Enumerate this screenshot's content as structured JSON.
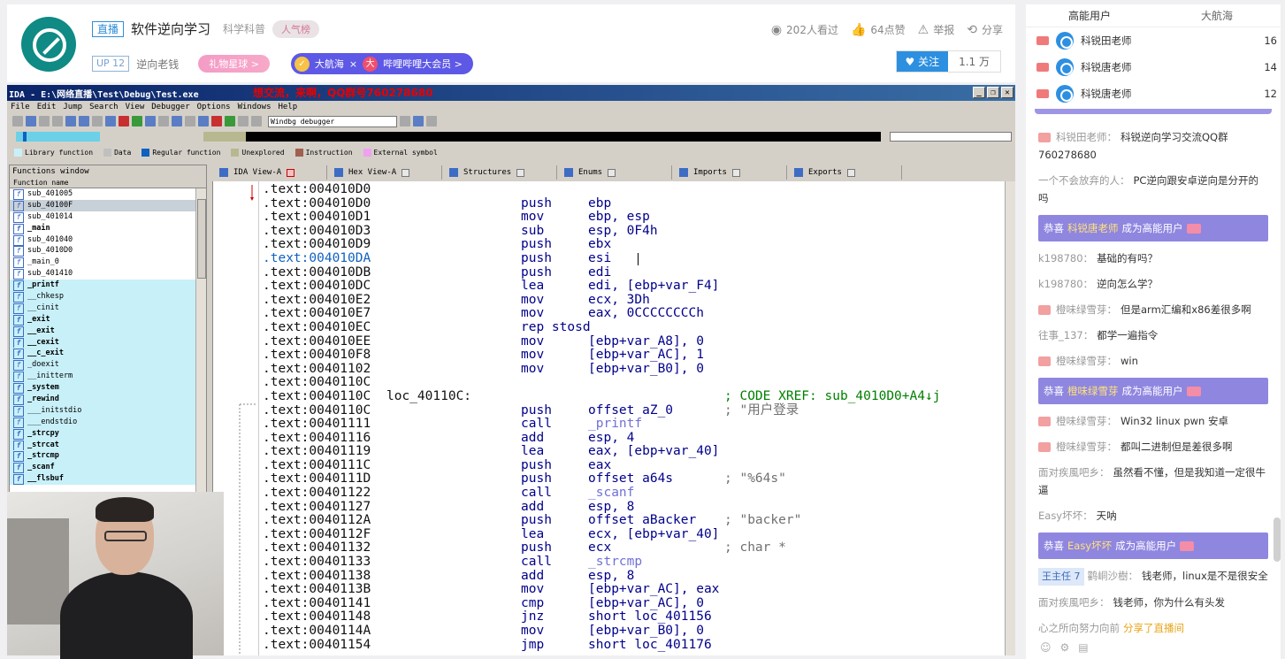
{
  "header": {
    "live_tag": "直播",
    "room_title": "软件逆向学习",
    "category": "科学科普",
    "popularity_badge": "人气榜",
    "up_level": "UP 12",
    "anchor_name": "逆向老钱",
    "gift_btn": "礼物星球 >",
    "guard_a": "大航海",
    "guard_sep": "×",
    "guard_b": "哔哩哔哩大会员 >",
    "viewers": "202人看过",
    "likes": "64点赞",
    "report": "举报",
    "share": "分享",
    "follow": "关注",
    "followers": "1.1 万"
  },
  "ida": {
    "title": "IDA - E:\\网络直播\\Test\\Debug\\Test.exe",
    "overlay": "想交流，来啊，QQ群号760278680",
    "menu": [
      "File",
      "Edit",
      "Jump",
      "Search",
      "View",
      "Debugger",
      "Options",
      "Windows",
      "Help"
    ],
    "debugger_select": "Windbg debugger",
    "legend": [
      "Library function",
      "Data",
      "Regular function",
      "Unexplored",
      "Instruction",
      "External symbol"
    ],
    "legend_colors": [
      "#c8f0f8",
      "#c0c0c0",
      "#1060c0",
      "#b8b890",
      "#a06050",
      "#f0a0f0"
    ],
    "functions_window_title": "Functions window",
    "function_column": "Function name",
    "functions": [
      {
        "name": "sub_401005",
        "style": "normal"
      },
      {
        "name": "sub_40100F",
        "style": "sel"
      },
      {
        "name": "sub_401014",
        "style": "normal"
      },
      {
        "name": "_main",
        "style": "bold"
      },
      {
        "name": "sub_401040",
        "style": "normal"
      },
      {
        "name": "sub_4010D0",
        "style": "normal"
      },
      {
        "name": "_main_0",
        "style": "normal"
      },
      {
        "name": "sub_401410",
        "style": "normal"
      },
      {
        "name": "_printf",
        "style": "lib bold"
      },
      {
        "name": "__chkesp",
        "style": "lib"
      },
      {
        "name": "__cinit",
        "style": "lib"
      },
      {
        "name": "_exit",
        "style": "lib bold"
      },
      {
        "name": "__exit",
        "style": "lib bold"
      },
      {
        "name": "__cexit",
        "style": "lib bold"
      },
      {
        "name": "__c_exit",
        "style": "lib bold"
      },
      {
        "name": "_doexit",
        "style": "lib"
      },
      {
        "name": "__initterm",
        "style": "lib"
      },
      {
        "name": "_system",
        "style": "lib bold"
      },
      {
        "name": "_rewind",
        "style": "lib bold"
      },
      {
        "name": "___initstdio",
        "style": "lib"
      },
      {
        "name": "___endstdio",
        "style": "lib"
      },
      {
        "name": "_strcpy",
        "style": "lib bold"
      },
      {
        "name": "_strcat",
        "style": "lib bold"
      },
      {
        "name": "_strcmp",
        "style": "lib bold"
      },
      {
        "name": "_scanf",
        "style": "lib bold"
      },
      {
        "name": "__flsbuf",
        "style": "lib bold"
      }
    ],
    "tabs": [
      "IDA View-A",
      "Hex View-A",
      "Structures",
      "Enums",
      "Imports",
      "Exports"
    ],
    "code": [
      {
        "addr": ".text:004010D0",
        "label": "",
        "mn": "",
        "op": "",
        "cm": ""
      },
      {
        "addr": ".text:004010D0",
        "label": "",
        "mn": "push",
        "op": "ebp",
        "cm": ""
      },
      {
        "addr": ".text:004010D1",
        "label": "",
        "mn": "mov",
        "op": "ebp, esp",
        "cm": ""
      },
      {
        "addr": ".text:004010D3",
        "label": "",
        "mn": "sub",
        "op": "esp, 0F4h",
        "cm": ""
      },
      {
        "addr": ".text:004010D9",
        "label": "",
        "mn": "push",
        "op": "ebx",
        "cm": ""
      },
      {
        "addr": ".text:004010DA",
        "label": "",
        "mn": "push",
        "op": "esi",
        "cm": ""
      },
      {
        "addr": ".text:004010DB",
        "label": "",
        "mn": "push",
        "op": "edi",
        "cm": ""
      },
      {
        "addr": ".text:004010DC",
        "label": "",
        "mn": "lea",
        "op": "edi, [ebp+var_F4]",
        "cm": ""
      },
      {
        "addr": ".text:004010E2",
        "label": "",
        "mn": "mov",
        "op": "ecx, 3Dh",
        "cm": ""
      },
      {
        "addr": ".text:004010E7",
        "label": "",
        "mn": "mov",
        "op": "eax, 0CCCCCCCCh",
        "cm": ""
      },
      {
        "addr": ".text:004010EC",
        "label": "",
        "mn": "rep stosd",
        "op": "",
        "cm": ""
      },
      {
        "addr": ".text:004010EE",
        "label": "",
        "mn": "mov",
        "op": "[ebp+var_A8], 0",
        "cm": ""
      },
      {
        "addr": ".text:004010F8",
        "label": "",
        "mn": "mov",
        "op": "[ebp+var_AC], 1",
        "cm": ""
      },
      {
        "addr": ".text:00401102",
        "label": "",
        "mn": "mov",
        "op": "[ebp+var_B0], 0",
        "cm": ""
      },
      {
        "addr": ".text:0040110C",
        "label": "",
        "mn": "",
        "op": "",
        "cm": ""
      },
      {
        "addr": ".text:0040110C",
        "label": "loc_40110C:",
        "mn": "",
        "op": "",
        "cm": "",
        "xref": "; CODE XREF: sub_4010D0+A4↓j"
      },
      {
        "addr": ".text:0040110C",
        "label": "",
        "mn": "push",
        "op": "offset aZ_0",
        "cm": "; \"用户登录"
      },
      {
        "addr": ".text:00401111",
        "label": "",
        "mn": "call",
        "op": "_printf",
        "cm": "",
        "fn": true
      },
      {
        "addr": ".text:00401116",
        "label": "",
        "mn": "add",
        "op": "esp, 4",
        "cm": ""
      },
      {
        "addr": ".text:00401119",
        "label": "",
        "mn": "lea",
        "op": "eax, [ebp+var_40]",
        "cm": ""
      },
      {
        "addr": ".text:0040111C",
        "label": "",
        "mn": "push",
        "op": "eax",
        "cm": ""
      },
      {
        "addr": ".text:0040111D",
        "label": "",
        "mn": "push",
        "op": "offset a64s",
        "cm": "; \"%64s\""
      },
      {
        "addr": ".text:00401122",
        "label": "",
        "mn": "call",
        "op": "_scanf",
        "cm": "",
        "fn": true
      },
      {
        "addr": ".text:00401127",
        "label": "",
        "mn": "add",
        "op": "esp, 8",
        "cm": ""
      },
      {
        "addr": ".text:0040112A",
        "label": "",
        "mn": "push",
        "op": "offset aBacker",
        "cm": "; \"backer\""
      },
      {
        "addr": ".text:0040112F",
        "label": "",
        "mn": "lea",
        "op": "ecx, [ebp+var_40]",
        "cm": ""
      },
      {
        "addr": ".text:00401132",
        "label": "",
        "mn": "push",
        "op": "ecx",
        "cm": "; char *"
      },
      {
        "addr": ".text:00401133",
        "label": "",
        "mn": "call",
        "op": "_strcmp",
        "cm": "",
        "fn": true
      },
      {
        "addr": ".text:00401138",
        "label": "",
        "mn": "add",
        "op": "esp, 8",
        "cm": ""
      },
      {
        "addr": ".text:0040113B",
        "label": "",
        "mn": "mov",
        "op": "[ebp+var_AC], eax",
        "cm": ""
      },
      {
        "addr": ".text:00401141",
        "label": "",
        "mn": "cmp",
        "op": "[ebp+var_AC], 0",
        "cm": ""
      },
      {
        "addr": ".text:00401148",
        "label": "",
        "mn": "jnz",
        "op": "short loc_401156",
        "cm": ""
      },
      {
        "addr": ".text:0040114A",
        "label": "",
        "mn": "mov",
        "op": "[ebp+var_B0], 0",
        "cm": ""
      },
      {
        "addr": ".text:00401154",
        "label": "",
        "mn": "jmp",
        "op": "short loc_401176",
        "cm": ""
      }
    ]
  },
  "panel": {
    "tab_high": "高能用户",
    "tab_guard": "大航海",
    "ranks": [
      {
        "name": "科锐田老师",
        "count": "16"
      },
      {
        "name": "科锐唐老师",
        "count": "14"
      },
      {
        "name": "科锐唐老师",
        "count": "12"
      }
    ],
    "chat": [
      {
        "type": "msg",
        "user": "科锐田老师：",
        "text": "科锐逆向学习交流QQ群760278680",
        "lv": true
      },
      {
        "type": "msg",
        "user": "一个不会放弃的人：",
        "text": "PC逆向跟安卓逆向是分开的吗",
        "lv": false
      },
      {
        "type": "sys",
        "pre": "恭喜",
        "name": "科锐唐老师",
        "post": "成为高能用户"
      },
      {
        "type": "msg",
        "user": "k198780：",
        "text": "基础的有吗？",
        "lv": false
      },
      {
        "type": "msg",
        "user": "k198780：",
        "text": "逆向怎么学？",
        "lv": false
      },
      {
        "type": "msg",
        "user": "橙味绿雪芽：",
        "text": "但是arm汇编和x86差很多啊",
        "lv": true
      },
      {
        "type": "msg",
        "user": "往事_137：",
        "text": "都学一遍指令",
        "lv": false
      },
      {
        "type": "msg",
        "user": "橙味绿雪芽：",
        "text": "win",
        "lv": true
      },
      {
        "type": "sys",
        "pre": "恭喜",
        "name": "橙味绿雪芽",
        "post": "成为高能用户"
      },
      {
        "type": "msg",
        "user": "橙味绿雪芽：",
        "text": "Win32 linux pwn 安卓",
        "lv": true
      },
      {
        "type": "msg",
        "user": "橙味绿雪芽：",
        "text": "都叫二进制但是差很多啊",
        "lv": true
      },
      {
        "type": "msg",
        "user": "面对疾風吧乡：",
        "text": "虽然看不懂，但是我知道一定很牛逼",
        "lv": false
      },
      {
        "type": "msg",
        "user": "Easy坏坏：",
        "text": "天呐",
        "lv": false
      },
      {
        "type": "sys",
        "pre": "恭喜",
        "name": "Easy坏坏",
        "post": "成为高能用户"
      },
      {
        "type": "vip",
        "tag": "王主任 7",
        "user": "鹳峒沙樹：",
        "text": "钱老师，linux是不是很安全"
      },
      {
        "type": "msg",
        "user": "面对疾風吧乡：",
        "text": "钱老师，你为什么有头发",
        "lv": false
      },
      {
        "type": "share",
        "user": "心之所向努力向前",
        "text": "分享了直播间"
      }
    ]
  }
}
